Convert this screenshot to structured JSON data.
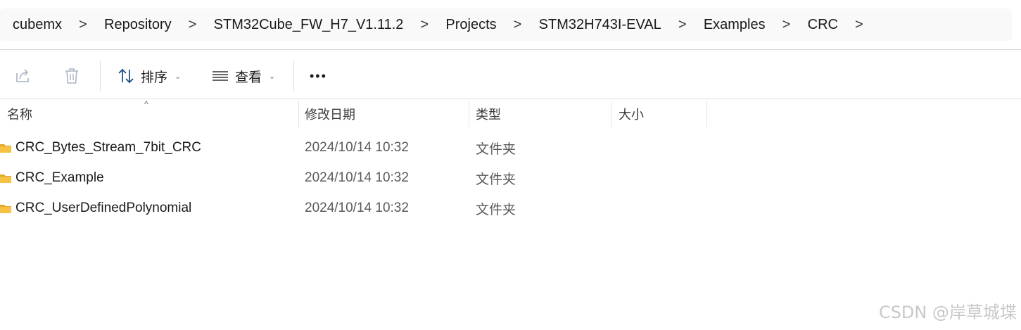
{
  "breadcrumb": [
    "cubemx",
    "Repository",
    "STM32Cube_FW_H7_V1.11.2",
    "Projects",
    "STM32H743I-EVAL",
    "Examples",
    "CRC"
  ],
  "breadcrumb_separator": ">",
  "toolbar": {
    "share_icon": "share-icon",
    "delete_icon": "trash-icon",
    "sort_label": "排序",
    "view_label": "查看",
    "more_label": "•••"
  },
  "columns": {
    "name": "名称",
    "modified": "修改日期",
    "type": "类型",
    "size": "大小"
  },
  "sort_indicator": "^",
  "files": [
    {
      "name": "CRC_Bytes_Stream_7bit_CRC",
      "modified": "2024/10/14 10:32",
      "type": "文件夹",
      "size": ""
    },
    {
      "name": "CRC_Example",
      "modified": "2024/10/14 10:32",
      "type": "文件夹",
      "size": ""
    },
    {
      "name": "CRC_UserDefinedPolynomial",
      "modified": "2024/10/14 10:32",
      "type": "文件夹",
      "size": ""
    }
  ],
  "watermark": "CSDN @岸草城堞",
  "colors": {
    "folder": "#f6c244",
    "folder_dark": "#e2a829",
    "icon_disabled": "#a9b4c2"
  }
}
